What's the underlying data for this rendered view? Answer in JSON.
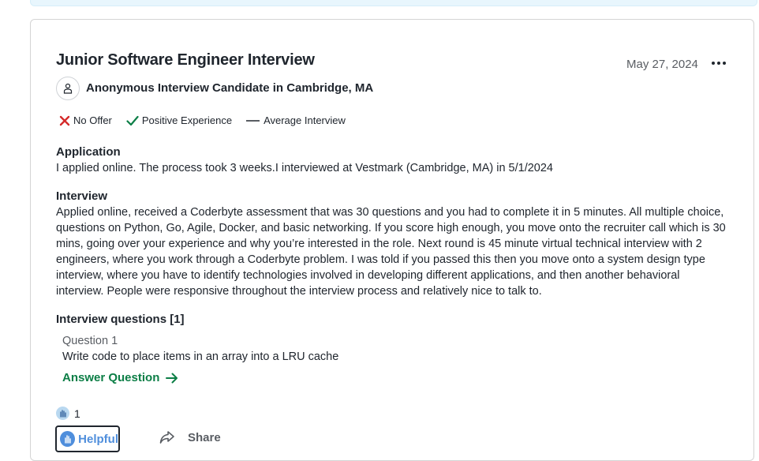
{
  "review": {
    "title": "Junior Software Engineer Interview",
    "date": "May 27, 2024",
    "author": "Anonymous Interview Candidate in Cambridge, MA",
    "ratings": [
      {
        "label": "No Offer",
        "icon": "x-icon",
        "color": "#d52b2b"
      },
      {
        "label": "Positive Experience",
        "icon": "check-icon",
        "color": "#0c7e46"
      },
      {
        "label": "Average Interview",
        "icon": "dash-icon",
        "color": "#595d63"
      }
    ],
    "application": {
      "heading": "Application",
      "text": "I applied online. The process took 3 weeks.I interviewed at Vestmark (Cambridge, MA) in 5/1/2024"
    },
    "interview": {
      "heading": "Interview",
      "text": "Applied online, received a Coderbyte assessment that was 30 questions and you had to complete it in 5 minutes. All multiple choice, questions on Python, Go, Agile, Docker, and basic networking. If you score high enough, you move onto the recruiter call which is 30 mins, going over your experience and why you’re interested in the role. Next round is 45 minute virtual technical interview with 2 engineers, where you work through a Coderbyte problem. I was told if you passed this then you move onto a system design type interview, where you have to identify technologies involved in developing different applications, and then another behavioral interview. People were responsive throughout the interview process and relatively nice to talk to."
    },
    "questions": {
      "heading": "Interview questions [1]",
      "items": [
        {
          "label": "Question 1",
          "text": "Write code to place items in an array into a LRU cache"
        }
      ],
      "answer_label": "Answer Question"
    },
    "reactions": {
      "count": "1",
      "helpful_label": "Helpful",
      "share_label": "Share"
    }
  }
}
